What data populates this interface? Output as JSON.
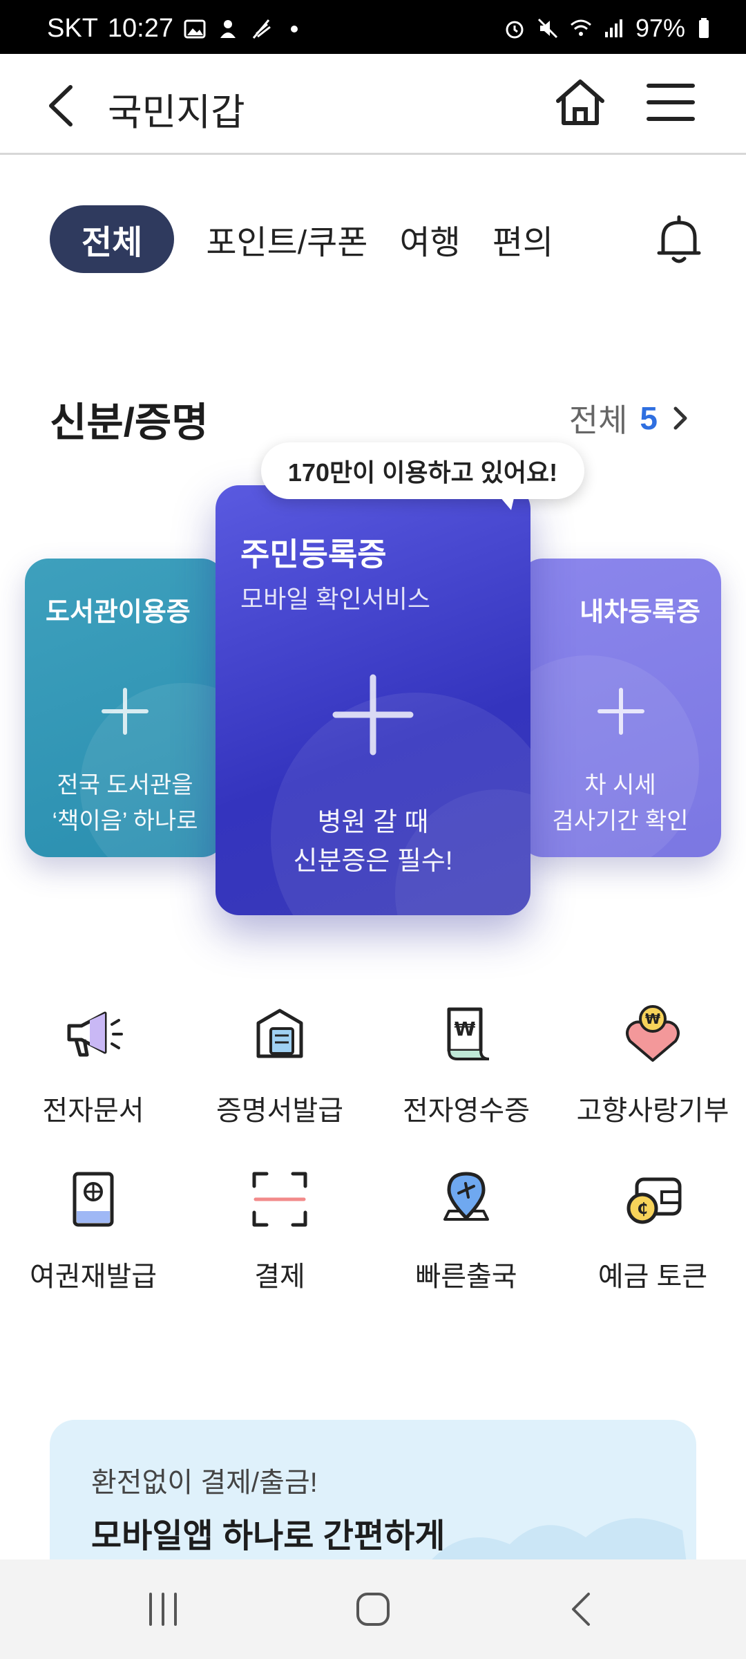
{
  "status_bar": {
    "carrier": "SKT",
    "time": "10:27",
    "battery": "97%"
  },
  "app_bar": {
    "title": "국민지갑"
  },
  "tabs": [
    {
      "label": "전체",
      "active": true
    },
    {
      "label": "포인트/쿠폰",
      "active": false
    },
    {
      "label": "여행",
      "active": false
    },
    {
      "label": "편의",
      "active": false
    }
  ],
  "section": {
    "title": "신분/증명",
    "more_label": "전체",
    "count": "5"
  },
  "tooltip": "170만이 이용하고 있어요!",
  "cards": {
    "left": {
      "name": "도서관이용증",
      "desc_line1": "전국 도서관을",
      "desc_line2": "‘책이음’ 하나로"
    },
    "center": {
      "name": "주민등록증",
      "sub": "모바일 확인서비스",
      "desc_line1": "병원 갈 때",
      "desc_line2": "신분증은 필수!"
    },
    "right": {
      "name": "내차등록증",
      "desc_line1": "차 시세",
      "desc_line2": "검사기간 확인"
    }
  },
  "services": [
    {
      "label": "전자문서",
      "icon": "megaphone-icon"
    },
    {
      "label": "증명서발급",
      "icon": "certificate-icon"
    },
    {
      "label": "전자영수증",
      "icon": "receipt-icon"
    },
    {
      "label": "고향사랑기부",
      "icon": "donation-icon"
    },
    {
      "label": "여권재발급",
      "icon": "passport-icon"
    },
    {
      "label": "결제",
      "icon": "scan-icon"
    },
    {
      "label": "빠른출국",
      "icon": "airport-pin-icon"
    },
    {
      "label": "예금 토큰",
      "icon": "wallet-coin-icon"
    }
  ],
  "banner": {
    "sub": "환전없이 결제/출금!",
    "title": "모바일앱 하나로 간편하게"
  },
  "colors": {
    "active_tab": "#2f3a5e",
    "accent_count": "#2f6fe0",
    "card_center": "#3434be",
    "card_left": "#2a8fb0",
    "card_right": "#7b77e2",
    "banner_bg": "#dff1fb"
  }
}
